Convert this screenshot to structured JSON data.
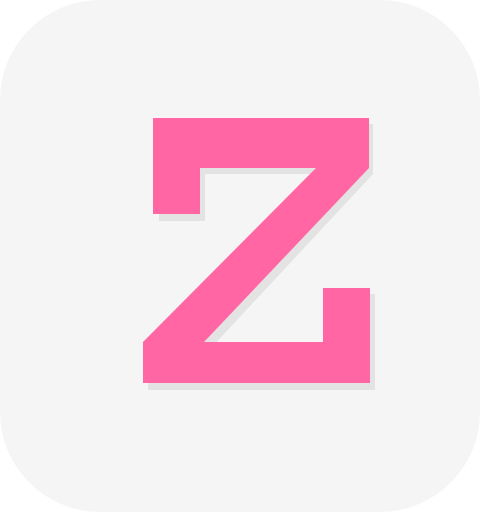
{
  "app_icon": {
    "letter": "Z",
    "background_color": "#f5f5f5",
    "letter_color": "#ff66a3",
    "shadow_color": "#e3e3e3",
    "icon": "letter-z-logo-icon"
  }
}
